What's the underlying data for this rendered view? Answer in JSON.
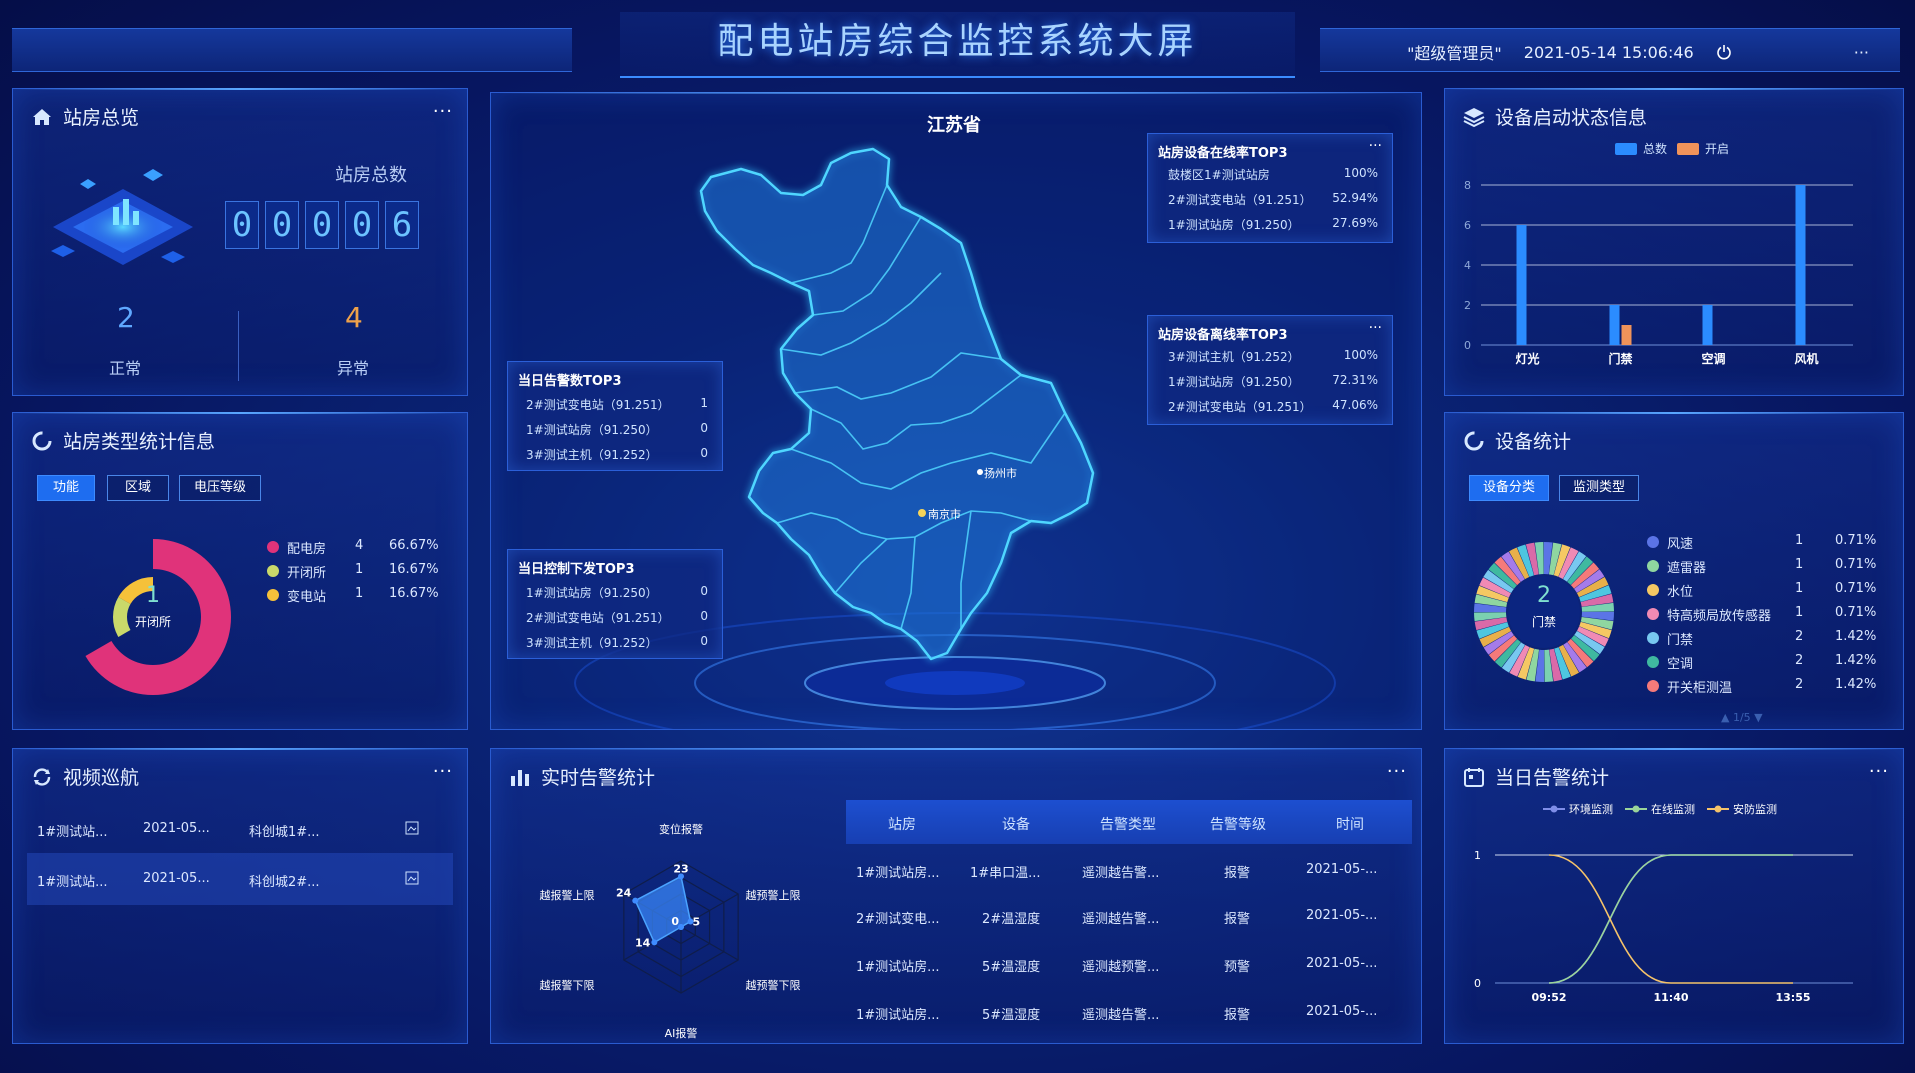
{
  "header": {
    "title": "配电站房综合监控系统大屏",
    "user": "\"超级管理员\"",
    "datetime": "2021-05-14 15:06:46",
    "more": "···"
  },
  "overview": {
    "title": "站房总览",
    "total_label": "站房总数",
    "digits": [
      "0",
      "0",
      "0",
      "0",
      "6"
    ],
    "normal_count": "2",
    "normal_label": "正常",
    "abnormal_count": "4",
    "abnormal_label": "异常",
    "more": "···"
  },
  "type_stats": {
    "title": "站房类型统计信息",
    "tabs": [
      "功能",
      "区域",
      "电压等级"
    ],
    "active_tab": 0,
    "center_value": "1",
    "center_label": "开闭所",
    "legend": [
      {
        "name": "配电房",
        "count": "4",
        "pct": "66.67%",
        "color": "#e0337a"
      },
      {
        "name": "开闭所",
        "count": "1",
        "pct": "16.67%",
        "color": "#c9d96a"
      },
      {
        "name": "变电站",
        "count": "1",
        "pct": "16.67%",
        "color": "#f5c13a"
      }
    ]
  },
  "video": {
    "title": "视频巡航",
    "more": "···",
    "rows": [
      {
        "station": "1#测试站...",
        "date": "2021-05...",
        "location": "科创城1#..."
      },
      {
        "station": "1#测试站...",
        "date": "2021-05...",
        "location": "科创城2#..."
      }
    ]
  },
  "map": {
    "province": "江苏省",
    "cities": [
      "扬州市",
      "南京市"
    ],
    "online_top3": {
      "title": "站房设备在线率TOP3",
      "rows": [
        {
          "name": "鼓楼区1#测试站房",
          "value": "100%"
        },
        {
          "name": "2#测试变电站（91.251）",
          "value": "52.94%"
        },
        {
          "name": "1#测试站房（91.250）",
          "value": "27.69%"
        }
      ]
    },
    "offline_top3": {
      "title": "站房设备离线率TOP3",
      "rows": [
        {
          "name": "3#测试主机（91.252）",
          "value": "100%"
        },
        {
          "name": "1#测试站房（91.250）",
          "value": "72.31%"
        },
        {
          "name": "2#测试变电站（91.251）",
          "value": "47.06%"
        }
      ]
    },
    "alarm_top3": {
      "title": "当日告警数TOP3",
      "rows": [
        {
          "name": "2#测试变电站（91.251）",
          "value": "1"
        },
        {
          "name": "1#测试站房（91.250）",
          "value": "0"
        },
        {
          "name": "3#测试主机（91.252）",
          "value": "0"
        }
      ]
    },
    "control_top3": {
      "title": "当日控制下发TOP3",
      "rows": [
        {
          "name": "1#测试站房（91.250）",
          "value": "0"
        },
        {
          "name": "2#测试变电站（91.251）",
          "value": "0"
        },
        {
          "name": "3#测试主机（91.252）",
          "value": "0"
        }
      ]
    },
    "more": "···"
  },
  "realtime": {
    "title": "实时告警统计",
    "more": "···",
    "radar_labels": [
      "变位报警",
      "越预警上限",
      "越预警下限",
      "AI报警",
      "越报警下限",
      "越报警上限"
    ],
    "table_headers": [
      "站房",
      "设备",
      "告警类型",
      "告警等级",
      "时间"
    ],
    "rows": [
      [
        "1#测试站房...",
        "1#串口温...",
        "遥测越告警...",
        "报警",
        "2021-05-..."
      ],
      [
        "2#测试变电...",
        "2#温湿度",
        "遥测越告警...",
        "报警",
        "2021-05-..."
      ],
      [
        "1#测试站房...",
        "5#温湿度",
        "遥测越预警...",
        "预警",
        "2021-05-..."
      ],
      [
        "1#测试站房...",
        "5#温湿度",
        "遥测越告警...",
        "报警",
        "2021-05-..."
      ]
    ]
  },
  "device_status": {
    "title": "设备启动状态信息",
    "legend": [
      {
        "name": "总数",
        "color": "#2b8cff"
      },
      {
        "name": "开启",
        "color": "#f0935a"
      }
    ]
  },
  "device_stats": {
    "title": "设备统计",
    "tabs": [
      "设备分类",
      "监测类型"
    ],
    "active_tab": 0,
    "center_value": "2",
    "center_label": "门禁",
    "legend": [
      {
        "name": "风速",
        "count": "1",
        "pct": "0.71%",
        "color": "#5b74e6"
      },
      {
        "name": "遮雷器",
        "count": "1",
        "pct": "0.71%",
        "color": "#8fd6a0"
      },
      {
        "name": "水位",
        "count": "1",
        "pct": "0.71%",
        "color": "#f5c863"
      },
      {
        "name": "特高频局放传感器",
        "count": "1",
        "pct": "0.71%",
        "color": "#f08ab4"
      },
      {
        "name": "门禁",
        "count": "2",
        "pct": "1.42%",
        "color": "#78c8f0"
      },
      {
        "name": "空调",
        "count": "2",
        "pct": "1.42%",
        "color": "#3fb9a0"
      },
      {
        "name": "开关柜测温",
        "count": "2",
        "pct": "1.42%",
        "color": "#f57a7a"
      }
    ],
    "pager": "1/5"
  },
  "daily_alarm": {
    "title": "当日告警统计",
    "more": "···"
  },
  "chart_data": [
    {
      "type": "bar",
      "categories": [
        "灯光",
        "门禁",
        "空调",
        "风机"
      ],
      "series": [
        {
          "name": "总数",
          "values": [
            6,
            2,
            2,
            8
          ]
        },
        {
          "name": "开启",
          "values": [
            0,
            1,
            0,
            0
          ]
        }
      ],
      "ylim": [
        0,
        8
      ],
      "yticks": [
        0,
        2,
        4,
        6,
        8
      ],
      "legend_position": "top"
    },
    {
      "type": "radar",
      "axes": [
        "变位报警",
        "越预警上限",
        "越预警下限",
        "AI报警",
        "越报警下限",
        "越报警上限"
      ],
      "values": [
        23,
        5,
        0,
        0,
        14,
        24
      ],
      "labels": [
        "23",
        "5",
        "0",
        "14",
        "24"
      ]
    },
    {
      "type": "line",
      "x": [
        "09:52",
        "11:40",
        "13:55"
      ],
      "series": [
        {
          "name": "环境监测",
          "values": [
            0,
            1,
            1
          ],
          "color": "#7f8ee8"
        },
        {
          "name": "在线监测",
          "values": [
            0,
            1,
            1
          ],
          "color": "#9ad49a"
        },
        {
          "name": "安防监测",
          "values": [
            1,
            0,
            0
          ],
          "color": "#f5c36a"
        }
      ],
      "yticks": [
        0,
        1
      ],
      "legend_position": "top"
    },
    {
      "type": "pie",
      "name": "站房类型",
      "slices": [
        {
          "name": "配电房",
          "value": 4,
          "color": "#e0337a"
        },
        {
          "name": "开闭所",
          "value": 1,
          "color": "#c9d96a"
        },
        {
          "name": "变电站",
          "value": 1,
          "color": "#f5c13a"
        }
      ]
    }
  ]
}
